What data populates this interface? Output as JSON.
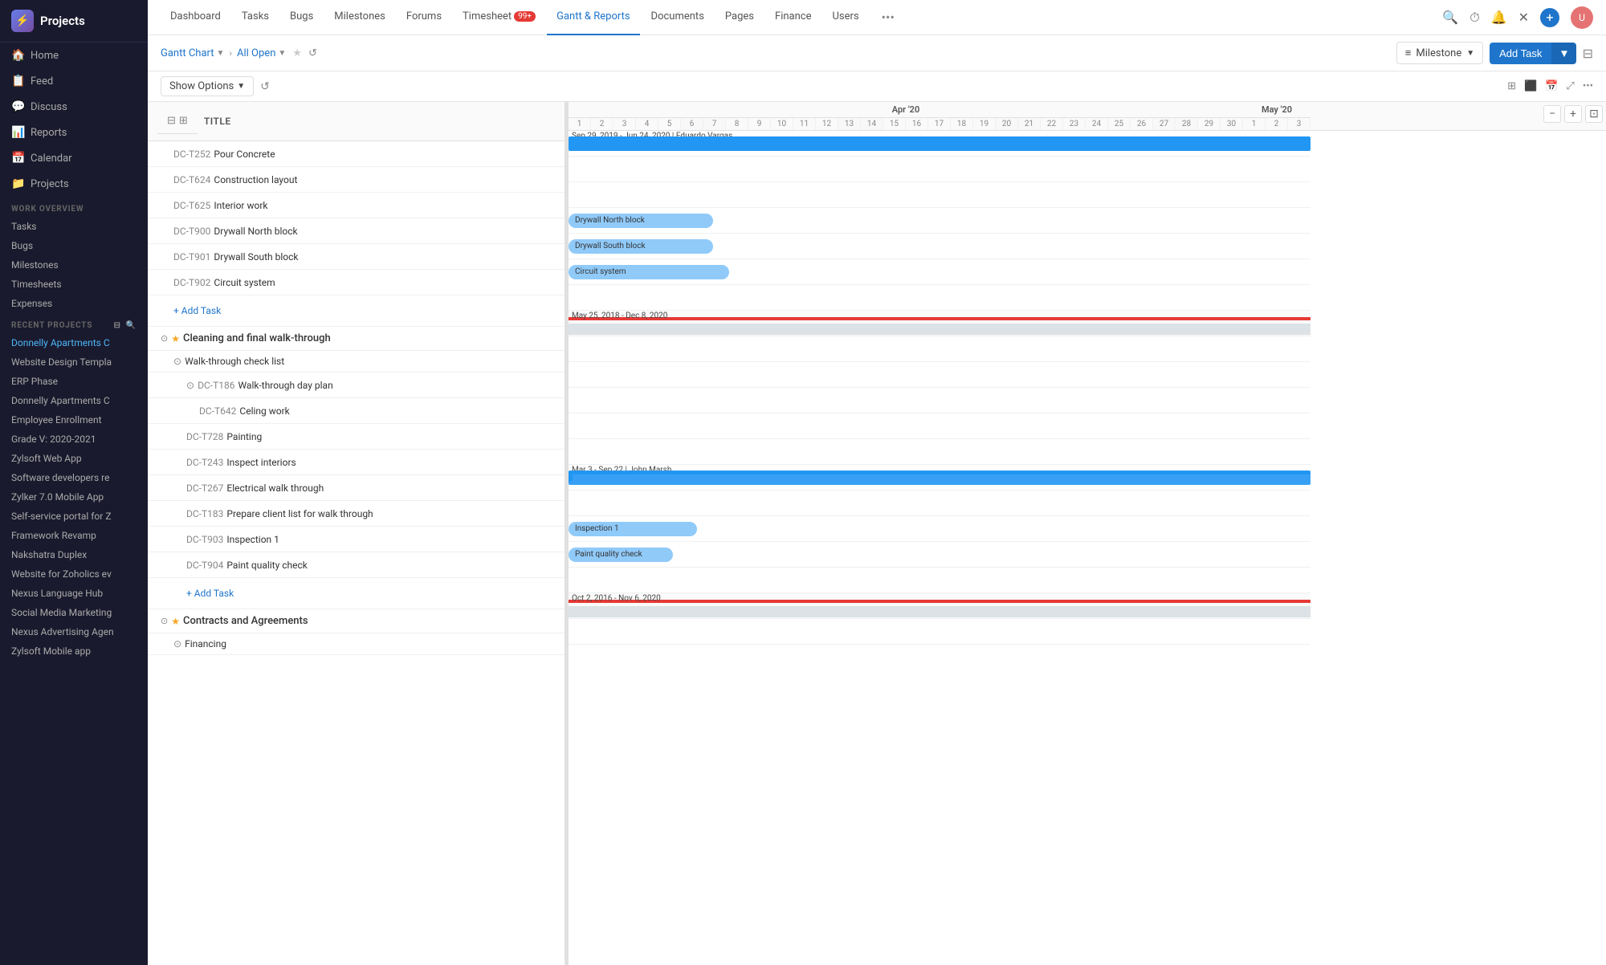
{
  "sidebar": {
    "logo": "⚡",
    "title": "Projects",
    "nav": [
      {
        "id": "home",
        "label": "Home",
        "icon": "🏠"
      },
      {
        "id": "feed",
        "label": "Feed",
        "icon": "📋"
      },
      {
        "id": "discuss",
        "label": "Discuss",
        "icon": "💬"
      },
      {
        "id": "reports",
        "label": "Reports",
        "icon": "📊"
      },
      {
        "id": "calendar",
        "label": "Calendar",
        "icon": "📅"
      },
      {
        "id": "projects",
        "label": "Projects",
        "icon": "📁"
      }
    ],
    "workOverview": {
      "title": "WORK OVERVIEW",
      "items": [
        "Tasks",
        "Bugs",
        "Milestones",
        "Timesheets",
        "Expenses"
      ]
    },
    "recentProjects": {
      "title": "RECENT PROJECTS",
      "items": [
        {
          "label": "Donnelly Apartments C",
          "active": true
        },
        {
          "label": "Website Design Templa",
          "active": false
        },
        {
          "label": "ERP Phase",
          "active": false
        },
        {
          "label": "Donnelly Apartments C",
          "active": false
        },
        {
          "label": "Employee Enrollment",
          "active": false
        },
        {
          "label": "Grade V: 2020-2021",
          "active": false
        },
        {
          "label": "Zylsoft Web App",
          "active": false
        },
        {
          "label": "Software developers re",
          "active": false
        },
        {
          "label": "Zylker 7.0 Mobile App",
          "active": false
        },
        {
          "label": "Self-service portal for Z",
          "active": false
        },
        {
          "label": "Framework Revamp",
          "active": false
        },
        {
          "label": "Nakshatra Duplex",
          "active": false
        },
        {
          "label": "Website for Zoholics ev",
          "active": false
        },
        {
          "label": "Nexus Language Hub",
          "active": false
        },
        {
          "label": "Social Media Marketing",
          "active": false
        },
        {
          "label": "Nexus Advertising Agen",
          "active": false
        },
        {
          "label": "Zylsoft Mobile app",
          "active": false
        }
      ]
    }
  },
  "topNav": {
    "tabs": [
      {
        "id": "dashboard",
        "label": "Dashboard",
        "active": false
      },
      {
        "id": "tasks",
        "label": "Tasks",
        "active": false
      },
      {
        "id": "bugs",
        "label": "Bugs",
        "active": false
      },
      {
        "id": "milestones",
        "label": "Milestones",
        "active": false
      },
      {
        "id": "forums",
        "label": "Forums",
        "active": false
      },
      {
        "id": "timesheet",
        "label": "Timesheet",
        "badge": "99+",
        "active": false
      },
      {
        "id": "gantt",
        "label": "Gantt & Reports",
        "active": true
      },
      {
        "id": "documents",
        "label": "Documents",
        "active": false
      },
      {
        "id": "pages",
        "label": "Pages",
        "active": false
      },
      {
        "id": "finance",
        "label": "Finance",
        "active": false
      },
      {
        "id": "users",
        "label": "Users",
        "active": false
      }
    ],
    "more": "•••"
  },
  "toolbar": {
    "breadcrumb": {
      "chart": "Gantt Chart",
      "sep": "›",
      "filter": "All Open"
    },
    "milestone_label": "Milestone",
    "add_task_label": "Add Task",
    "show_options_label": "Show Options"
  },
  "gantt": {
    "months": [
      {
        "label": "Apr '20",
        "days": [
          1,
          2,
          3,
          4,
          5,
          6,
          7,
          8,
          9,
          10,
          11,
          12,
          13,
          14,
          15,
          16,
          17,
          18,
          19,
          20,
          21,
          22,
          23,
          24,
          25,
          26,
          27,
          28,
          29,
          30
        ]
      },
      {
        "label": "May '20",
        "days": [
          1,
          2,
          3
        ]
      }
    ],
    "spanLabels": [
      {
        "text": "Sep 29, 2019 - Jun 24, 2020 | Eduardo Vargas",
        "row": 1,
        "color": "#2196f3"
      },
      {
        "text": "May 25, 2018 - Dec 8, 2020",
        "row": 10,
        "color": "#e53935"
      },
      {
        "text": "Mar 3 - Sep 22 | John Marsh",
        "row": 14,
        "color": "#2196f3"
      },
      {
        "text": "Oct 2, 2016 - Nov 6, 2020",
        "row": 22,
        "color": "#e53935"
      }
    ],
    "tasks": [
      {
        "id": "DC-T252",
        "name": "Pour Concrete",
        "indent": 2,
        "hasBar": false
      },
      {
        "id": "DC-T624",
        "name": "Construction layout",
        "indent": 2,
        "hasBar": false
      },
      {
        "id": "DC-T625",
        "name": "Interior work",
        "indent": 2,
        "hasBar": false
      },
      {
        "id": "DC-T900",
        "name": "Drywall North block",
        "indent": 2,
        "hasBar": true,
        "barLabel": "Drywall North block"
      },
      {
        "id": "DC-T901",
        "name": "Drywall South block",
        "indent": 2,
        "hasBar": true,
        "barLabel": "Drywall South block"
      },
      {
        "id": "DC-T902",
        "name": "Circuit system",
        "indent": 2,
        "hasBar": true,
        "barLabel": "Circuit system"
      },
      {
        "id": "",
        "name": "Add Task",
        "isAddTask": true,
        "indent": 2
      },
      {
        "id": "",
        "name": "Cleaning and final walk-through",
        "isGroup": true,
        "groupIndent": 1
      },
      {
        "id": "",
        "name": "Walk-through check list",
        "isSubGroup": true,
        "indent": 2
      },
      {
        "id": "DC-T186",
        "name": "Walk-through day plan",
        "indent": 3,
        "hasSubExpand": true
      },
      {
        "id": "DC-T642",
        "name": "Celing work",
        "indent": 4
      },
      {
        "id": "DC-T728",
        "name": "Painting",
        "indent": 3
      },
      {
        "id": "DC-T243",
        "name": "Inspect interiors",
        "indent": 3
      },
      {
        "id": "DC-T267",
        "name": "Electrical walk through",
        "indent": 3
      },
      {
        "id": "DC-T183",
        "name": "Prepare client list for walk through",
        "indent": 3
      },
      {
        "id": "DC-T903",
        "name": "Inspection 1",
        "indent": 3,
        "hasBar": true,
        "barLabel": "Inspection 1"
      },
      {
        "id": "DC-T904",
        "name": "Paint quality check",
        "indent": 3,
        "hasBar": true,
        "barLabel": "Paint quality check"
      },
      {
        "id": "",
        "name": "Add Task",
        "isAddTask": true,
        "indent": 3
      },
      {
        "id": "",
        "name": "Contracts and Agreements",
        "isGroup": true,
        "groupIndent": 1
      },
      {
        "id": "",
        "name": "Financing",
        "isSubGroup": true,
        "indent": 2
      }
    ]
  }
}
